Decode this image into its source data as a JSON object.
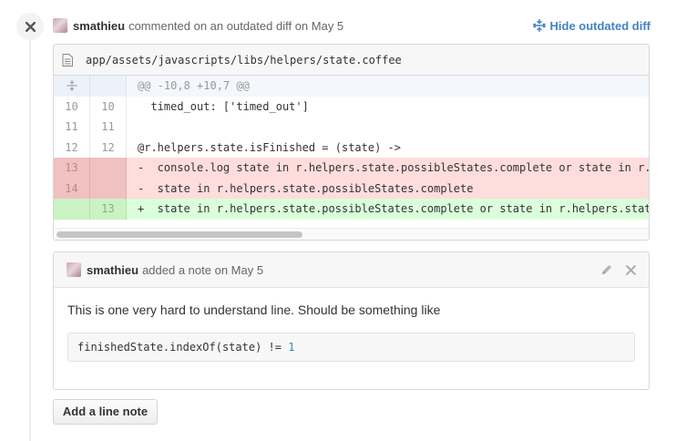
{
  "comment": {
    "author": "smathieu",
    "action": "commented on an outdated diff on May 5",
    "hide_link": "Hide outdated diff"
  },
  "file": {
    "path": "app/assets/javascripts/libs/helpers/state.coffee"
  },
  "diff": {
    "hunk_header": "@@ -10,8 +10,7 @@",
    "lines": [
      {
        "type": "context",
        "old": "10",
        "new": "10",
        "code": "  timed_out: ['timed_out']"
      },
      {
        "type": "context",
        "old": "11",
        "new": "11",
        "code": ""
      },
      {
        "type": "context",
        "old": "12",
        "new": "12",
        "code": "@r.helpers.state.isFinished = (state) ->"
      },
      {
        "type": "deletion",
        "old": "13",
        "new": "",
        "code": "-  console.log state in r.helpers.state.possibleStates.complete or state in r.helpers.state.possibleStates.failed"
      },
      {
        "type": "deletion",
        "old": "14",
        "new": "",
        "code": "-  state in r.helpers.state.possibleStates.complete"
      },
      {
        "type": "addition",
        "old": "",
        "new": "13",
        "code": "+  state in r.helpers.state.possibleStates.complete or state in r.helpers.state.possibleStates.failed"
      }
    ]
  },
  "note": {
    "author": "smathieu",
    "action": "added a note on May 5",
    "text": "This is one very hard to understand line. Should be something like",
    "code_prefix": "finishedState.indexOf(state) != ",
    "code_number": "1"
  },
  "add_note_button": "Add a line note",
  "icons": {
    "close": "close-icon",
    "unfold": "unfold-icon",
    "file": "file-icon",
    "pencil": "pencil-icon"
  },
  "colors": {
    "link": "#4183c4",
    "deletion_bg": "#ffdddd",
    "addition_bg": "#dbffdb"
  }
}
